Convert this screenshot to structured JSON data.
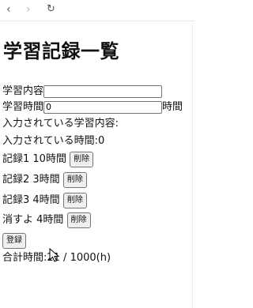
{
  "browser": {
    "back_icon": "‹",
    "forward_icon": "›",
    "reload_icon": "↻"
  },
  "page": {
    "title": "学習記録一覧",
    "content_label": "学習内容",
    "content_value": "",
    "time_label": "学習時間",
    "time_value": "0",
    "time_unit": "時間",
    "entered_content_text": "入力されている学習内容:",
    "entered_time_text": "入力されている時間:0",
    "records": [
      {
        "text": "記録1 10時間",
        "delete_label": "削除"
      },
      {
        "text": "記録2 3時間",
        "delete_label": "削除"
      },
      {
        "text": "記録3 4時間",
        "delete_label": "削除"
      },
      {
        "text": "消すよ 4時間",
        "delete_label": "削除"
      }
    ],
    "register_label": "登録",
    "total_text": "合計時間:21 / 1000(h)"
  }
}
